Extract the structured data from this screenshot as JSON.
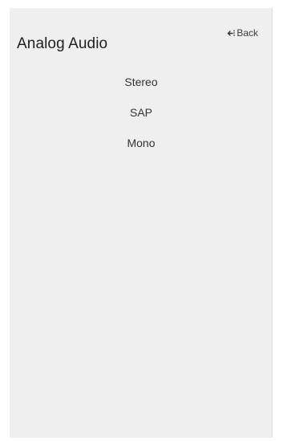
{
  "header": {
    "title": "Analog Audio",
    "back_label": "Back",
    "back_icon": "back-arrow-icon"
  },
  "menu": {
    "items": [
      {
        "label": "Stereo"
      },
      {
        "label": "SAP"
      },
      {
        "label": "Mono"
      }
    ]
  },
  "colors": {
    "panel_background": "#efefef",
    "text": "#333333"
  }
}
